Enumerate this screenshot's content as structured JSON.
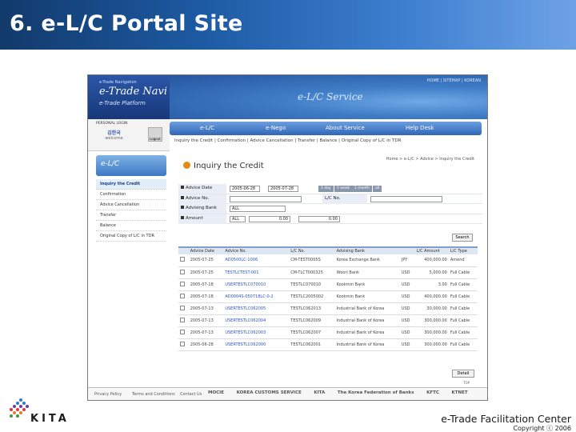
{
  "slide": {
    "title": "6. e-L/C Portal Site",
    "org_center": "e-Trade Facilitation Center",
    "copyright": "Copyright ⓒ 2006",
    "logo_text": "KITA"
  },
  "portal": {
    "brand_small": "e-Trade Navigation",
    "brand_name": "e-Trade Navi",
    "brand_sub": "e-Trade Platform",
    "top_nav": "HOME | SITEMAP | KOREAN",
    "service_title": "e-L/C Service",
    "login": {
      "id_label": "PERSONAL LOGIN",
      "welcome_name": "김한국",
      "welcome_text": "welcome",
      "logout_label": "Logout"
    },
    "menu": [
      "e-L/C",
      "e-Nego",
      "About Service",
      "Help Desk"
    ],
    "submenu": "Inquiry the Credit | Confirmation | Advice Cancellation | Transfer | Balance | Original Copy of L/C in TDR",
    "left_title": "e-L/C",
    "left_items": [
      "Inquiry the Credit",
      "Confirmation",
      "Advice Cancellation",
      "Transfer",
      "Balance",
      "Original Copy of L/C in TDR"
    ],
    "page_title": "Inquiry the Credit",
    "breadcrumb": "Home > e-L/C > Advice > Inquiry the Credit",
    "form": {
      "advice_date_label": "Advice Date",
      "date_from": "2005-06-28",
      "date_to": "2005-07-28",
      "quick_buttons": [
        "1 day",
        "1 week",
        "1 month",
        "all"
      ],
      "lc_no_label": "L/C No.",
      "advice_no_label": "Advice No.",
      "advising_bank_label": "Advising Bank",
      "advising_bank_value": "ALL",
      "amount_label": "Amount",
      "currency_value": "ALL",
      "amount_from": "0.00",
      "amount_to": "0.00",
      "search_label": "Search"
    },
    "table": {
      "headers": [
        "",
        "Advice Date",
        "Advice No.",
        "L/C No.",
        "Advising Bank",
        "",
        "L/C Amount",
        "L/C Type"
      ],
      "rows": [
        {
          "date": "2005-07-25",
          "advice_no": "AD0500LC-1006",
          "lc_no": "CM-TEST0005S",
          "bank": "Korea Exchange Bank",
          "cur": "JPY",
          "amount": "400,000.00",
          "type": "Amend"
        },
        {
          "date": "2005-07-25",
          "advice_no": "TESTLCTEST-001",
          "lc_no": "CM-TLCT000325",
          "bank": "Woori Bank",
          "cur": "USD",
          "amount": "5,000.00",
          "type": "Full Cable"
        },
        {
          "date": "2005-07-18",
          "advice_no": "USERTESTLC070010",
          "lc_no": "TESTLC070010",
          "bank": "Kookmin Bank",
          "cur": "USD",
          "amount": "3.00",
          "type": "Full Cable"
        },
        {
          "date": "2005-07-18",
          "advice_no": "AD0004S-050718LC-0-2",
          "lc_no": "TESTLC2005002",
          "bank": "Kookmin Bank",
          "cur": "USD",
          "amount": "400,000.00",
          "type": "Full Cable"
        },
        {
          "date": "2005-07-13",
          "advice_no": "USERTESTLC062005",
          "lc_no": "TESTLC062013",
          "bank": "Industrial Bank of Korea",
          "cur": "USD",
          "amount": "30,000.00",
          "type": "Full Cable"
        },
        {
          "date": "2005-07-13",
          "advice_no": "USERTESTLC062004",
          "lc_no": "TESTLC062009",
          "bank": "Industrial Bank of Korea",
          "cur": "USD",
          "amount": "300,000.00",
          "type": "Full Cable"
        },
        {
          "date": "2005-07-13",
          "advice_no": "USERTESTLC062003",
          "lc_no": "TESTLC062007",
          "bank": "Industrial Bank of Korea",
          "cur": "USD",
          "amount": "300,000.00",
          "type": "Full Cable"
        },
        {
          "date": "2005-06-28",
          "advice_no": "USERTESTLC062000",
          "lc_no": "TESTLC062001",
          "bank": "Industrial Bank of Korea",
          "cur": "USD",
          "amount": "300,000.00",
          "type": "Full Cable"
        }
      ]
    },
    "detail_label": "Detail",
    "top_label": "TOP",
    "footer": {
      "links": [
        "Privacy Policy",
        "Terms and Conditions",
        "Contact Us"
      ],
      "logos": [
        "MOCIE",
        "KOREA CUSTOMS SERVICE",
        "KITA",
        "The Korea Federation of Banks",
        "KFTC",
        "KTNET"
      ]
    }
  }
}
